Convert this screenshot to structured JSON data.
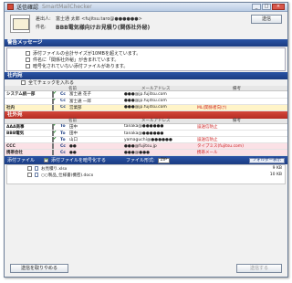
{
  "window": {
    "title": "送信確認",
    "app_name": "SmartMailChecker",
    "minimize": "_",
    "maximize": "□",
    "close": "×"
  },
  "header": {
    "from_label": "差出人:",
    "from_value": "富士通 太郎 <fujitsu.taro@●●●●●●>",
    "subject_label": "件名:",
    "subject_value": "BBB電気様向けお見積り(関係社外秘)",
    "send_button": "送信"
  },
  "warning": {
    "section_title": "警告メッセージ",
    "rows": [
      {
        "text": "添付ファイルの合計サイズが10MBを超えています。",
        "checked": false
      },
      {
        "text": "件名に「関係社外秘」が含まれています。",
        "checked": false
      },
      {
        "text": "暗号化されていない添付ファイルがあります。",
        "checked": false
      }
    ]
  },
  "internal": {
    "section_title": "社内宛",
    "check_all": "全てチェックを入れる",
    "col_name": "名前",
    "col_email": "メールアドレス",
    "col_note": "備考",
    "rows": [
      {
        "org": "システム統一部",
        "type": "Cc",
        "name": "富士通 花子",
        "email": "●●●@jp.fujitsu.com",
        "note": "",
        "checked": true
      },
      {
        "org": "",
        "type": "Cc",
        "name": "富士通 一郎",
        "email": "●●●@jp.fujitsu.com",
        "note": "",
        "checked": true
      },
      {
        "org": "社内",
        "type": "Cc",
        "name": "営業部",
        "email": "●●●@jp.fujitsu.com",
        "note": "ML(関係者向け)",
        "checked": false
      }
    ]
  },
  "external": {
    "section_title": "社外宛",
    "col_name": "名前",
    "col_email": "メールアドレス",
    "col_note": "備考",
    "groups": [
      {
        "org": "AAA商事",
        "rows": [
          {
            "type": "To",
            "name": "田中",
            "email": "tanaka@●●●●●●",
            "note": "誤送信防止",
            "checked": true
          }
        ]
      },
      {
        "org": "BBB電気",
        "rows": [
          {
            "type": "To",
            "name": "田中",
            "email": "tanaka@●●●●●●",
            "note": "",
            "checked": true
          },
          {
            "type": "To",
            "name": "山口",
            "email": "yamaguchi@●●●●●●",
            "note": "誤送信防止",
            "checked": true
          }
        ]
      },
      {
        "org": "CCC",
        "rows": [
          {
            "type": "Cc",
            "name": "●●",
            "email": "●●●@fujitsu.jp",
            "note": "タイプミス(fujitsu.com)",
            "checked": false
          }
        ]
      },
      {
        "org": "携帯会社",
        "rows": [
          {
            "type": "Cc",
            "name": "●●",
            "email": "●●●@●●●",
            "note": "携帯メール",
            "checked": false
          }
        ]
      }
    ]
  },
  "attachments": {
    "section_title": "添付ファイル",
    "encrypt_label": "添付ファイルを暗号化する",
    "format_label": "ファイル形式:",
    "format_value": "ZIP",
    "folder_button": "フォルダー表示",
    "files": [
      {
        "name": "お見積り.xlsx",
        "size": "9 KB",
        "checked": false
      },
      {
        "name": "○○製品_仕様書(機密).docx",
        "size": "10 KB",
        "checked": false
      }
    ]
  },
  "footer": {
    "left_button": "送信を取りやめる",
    "right_button": "送信する"
  },
  "colors": {
    "blue": "#1b3c82",
    "red": "#c23a2f",
    "pink": "#f4a6b4"
  }
}
